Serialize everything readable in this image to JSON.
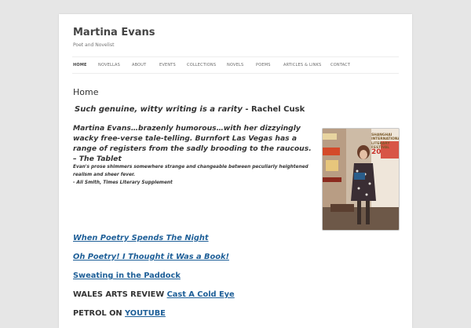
{
  "site": {
    "title": "Martina Evans",
    "description": "Poet and Novelist"
  },
  "nav": {
    "items": [
      {
        "label": "HOME",
        "active": true
      },
      {
        "label": "NOVELLAS"
      },
      {
        "label": "ABOUT"
      },
      {
        "label": "EVENTS"
      },
      {
        "label": "COLLECTIONS"
      },
      {
        "label": "NOVELS"
      },
      {
        "label": "POEMS"
      },
      {
        "label": "ARTICLES & LINKS"
      },
      {
        "label": "CONTACT"
      }
    ]
  },
  "page": {
    "title": "Home",
    "quote1": {
      "text": "Such genuine, witty writing is a rarity",
      "attribution": " - Rachel Cusk"
    },
    "quote2": "Martina Evans…brazenly humorous…with her dizzyingly wacky free-verse tale-telling. Burnfort Las Vegas has a range of registers from the sadly brooding to the raucous. – The Tablet",
    "quote3": {
      "text": "Evan's prose shimmers somewhere strange and changeable between peculiarly heightened realism and sheer fever.",
      "attribution": "- Ali Smith, Times Literary Supplement"
    },
    "photo": {
      "banner_text": "SHANGHAI INTERNATIONAL LITERARY FESTIVAL",
      "banner_year": "20"
    },
    "links": [
      {
        "prefix": "",
        "label": "When Poetry Spends The Night "
      },
      {
        "prefix": "",
        "label": "Oh Poetry! I Thought it Was a Book!"
      },
      {
        "prefix": "",
        "label": "Sweating in the Paddock"
      },
      {
        "prefix": "WALES ARTS REVIEW ",
        "label": "Cast A Cold Eye"
      },
      {
        "prefix": "PETROL ON ",
        "label": "YOUTUBE"
      }
    ]
  },
  "colors": {
    "background": "#e6e6e6",
    "page": "#ffffff",
    "link": "#1e5f98",
    "text": "#333333"
  }
}
